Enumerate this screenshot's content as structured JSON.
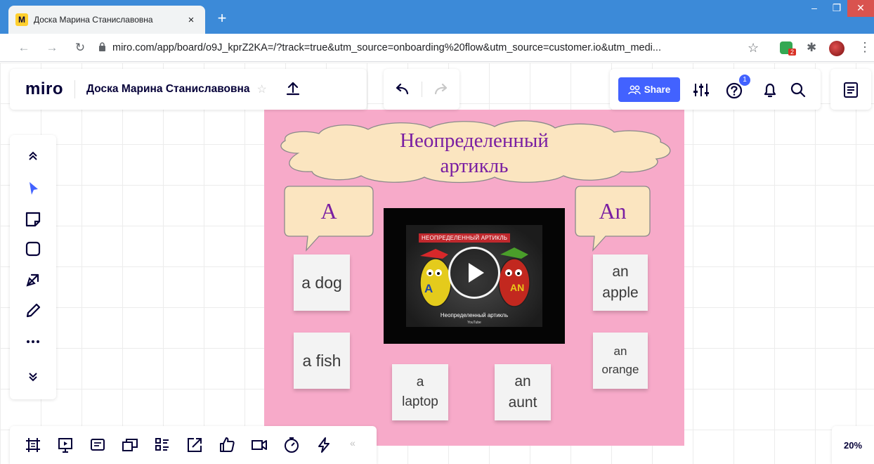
{
  "browser": {
    "tab_title": "Доска Марина Станиславовна",
    "tab_close": "×",
    "new_tab": "+",
    "url": "miro.com/app/board/o9J_kprZ2KA=/?track=true&utm_source=onboarding%20flow&utm_source=customer.io&utm_medi...",
    "extension_badge": "2",
    "window_controls": {
      "minimize": "–",
      "maximize": "❐",
      "close": "✕"
    }
  },
  "miro": {
    "logo": "miro",
    "board_title": "Доска Марина Станиславовна",
    "share_label": "Share",
    "help_badge": "1",
    "zoom": "20%",
    "bottom_collapse": "«"
  },
  "board": {
    "cloud_line1": "Неопределенный",
    "cloud_line2": "артикль",
    "bubble_left": "A",
    "bubble_right": "An",
    "stickies": [
      {
        "text": "a dog"
      },
      {
        "text": "a fish"
      },
      {
        "line1": "a",
        "line2": "laptop"
      },
      {
        "line1": "an",
        "line2": "aunt"
      },
      {
        "line1": "an",
        "line2": "apple"
      },
      {
        "line1": "an",
        "line2": "orange"
      }
    ],
    "video": {
      "banner": "НЕОПРЕДЕЛЕННЫЙ АРТИКЛЬ",
      "caption": "Неопределенный артикль",
      "source": "YouTube",
      "char_left": "A",
      "char_right": "AN"
    }
  },
  "colors": {
    "frame": "#f7aac9",
    "cloud_fill": "#fbe5c0",
    "text_purple": "#7a1fa2",
    "share_blue": "#4262ff",
    "tab_blue": "#3c8ad8"
  }
}
